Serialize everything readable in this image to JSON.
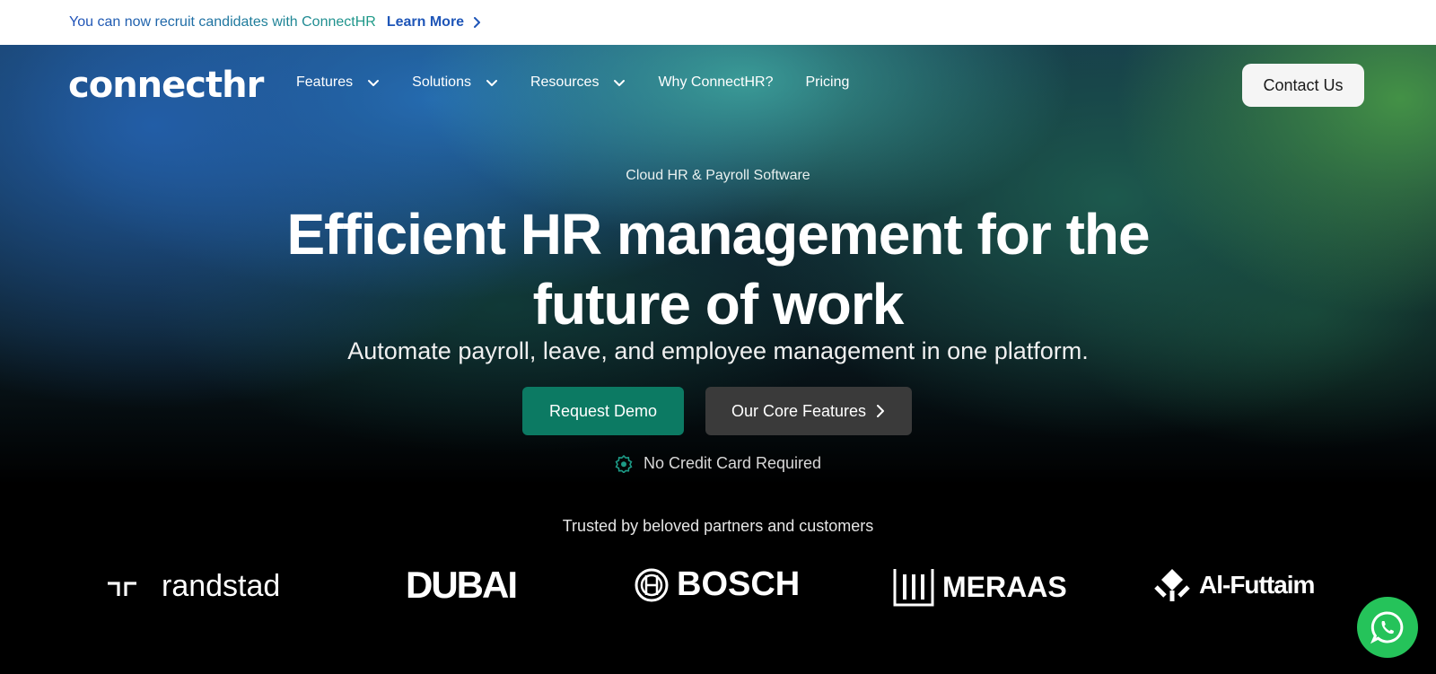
{
  "announcement": {
    "text": "You can now recruit candidates with ConnectHR",
    "link_label": "Learn More"
  },
  "nav": {
    "logo": "connecthr",
    "items": [
      {
        "label": "Features",
        "has_dropdown": true
      },
      {
        "label": "Solutions",
        "has_dropdown": true
      },
      {
        "label": "Resources",
        "has_dropdown": true
      },
      {
        "label": "Why ConnectHR?",
        "has_dropdown": false
      },
      {
        "label": "Pricing",
        "has_dropdown": false
      }
    ],
    "contact_label": "Contact Us"
  },
  "hero": {
    "eyebrow": "Cloud HR & Payroll Software",
    "headline_line1": "Efficient HR management for the",
    "headline_line2": "future of work",
    "subheadline": "Automate payroll, leave, and employee management in one platform.",
    "primary_cta": "Request Demo",
    "secondary_cta": "Our Core Features",
    "note": "No Credit Card Required"
  },
  "trusted": {
    "heading": "Trusted by beloved partners and customers",
    "brands": [
      "randstad",
      "DUBAI",
      "BOSCH",
      "MERAAS",
      "Al-Futtaim"
    ]
  },
  "colors": {
    "primary_green": "#0c7a63",
    "link_blue": "#1f56b8",
    "whatsapp_green": "#25c35a"
  },
  "icons": {
    "learn_more": "chevron-right-icon",
    "dropdown": "chevron-down-icon",
    "note": "badge-check-icon",
    "chat": "whatsapp-icon"
  }
}
